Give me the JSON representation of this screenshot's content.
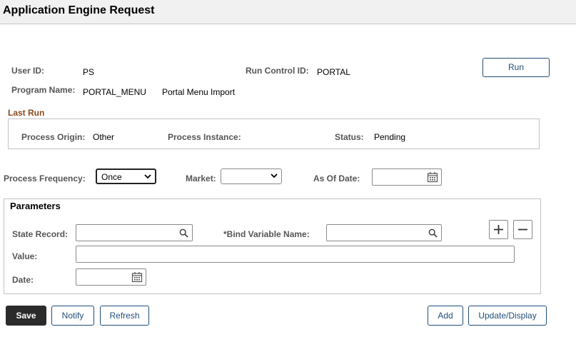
{
  "page": {
    "title": "Application Engine Request"
  },
  "run": {
    "label": "Run"
  },
  "fields": {
    "user_id": {
      "label": "User ID:",
      "value": "PS"
    },
    "run_control_id": {
      "label": "Run Control ID:",
      "value": "PORTAL"
    },
    "program_name": {
      "label": "Program Name:",
      "value": "PORTAL_MENU",
      "description": "Portal Menu Import"
    }
  },
  "last_run": {
    "title": "Last Run",
    "process_origin": {
      "label": "Process Origin:",
      "value": "Other"
    },
    "process_instance": {
      "label": "Process Instance:",
      "value": ""
    },
    "status": {
      "label": "Status:",
      "value": "Pending"
    }
  },
  "schedule": {
    "frequency": {
      "label": "Process Frequency:",
      "value": "Once"
    },
    "market": {
      "label": "Market:",
      "value": ""
    },
    "as_of_date": {
      "label": "As Of Date:",
      "value": ""
    }
  },
  "parameters": {
    "title": "Parameters",
    "state_record": {
      "label": "State Record:",
      "value": ""
    },
    "bind_variable": {
      "label": "*Bind Variable Name:",
      "value": ""
    },
    "value": {
      "label": "Value:",
      "value": ""
    },
    "date": {
      "label": "Date:",
      "value": ""
    }
  },
  "footer": {
    "save": "Save",
    "notify": "Notify",
    "refresh": "Refresh",
    "add": "Add",
    "update_display": "Update/Display"
  },
  "icons": {
    "calendar": "calendar-icon",
    "search": "search-icon",
    "chevron": "chevron-down-icon",
    "plus": "plus-icon",
    "minus": "minus-icon"
  }
}
